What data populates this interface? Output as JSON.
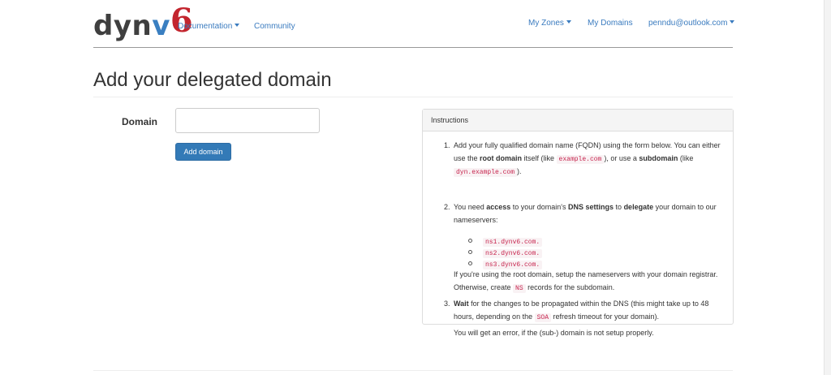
{
  "nav": {
    "logo_dyn": "dyn",
    "logo_v": "v",
    "logo_6": "6",
    "documentation": "Documentation",
    "community": "Community",
    "my_zones": "My Zones",
    "my_domains": "My Domains",
    "user_email": "penndu@outlook.com"
  },
  "page": {
    "title": "Add your delegated domain"
  },
  "form": {
    "domain_label": "Domain",
    "domain_value": "",
    "domain_placeholder": "",
    "submit_label": "Add domain"
  },
  "instructions": {
    "heading": "Instructions",
    "step1": {
      "num": "1.",
      "t1": "Add your fully qualified domain name (FQDN) using the form below. You can either use the ",
      "b1": "root domain",
      "t2": " itself (like ",
      "c1": "example.com",
      "t3": "), or use a ",
      "b2": "subdomain",
      "t4": " (like ",
      "c2": "dyn.example.com",
      "t5": ")."
    },
    "step2": {
      "num": "2.",
      "t1": "You need ",
      "b1": "access",
      "t2": " to your domain's ",
      "b2": "DNS settings",
      "t3": " to ",
      "b3": "delegate",
      "t4": " your domain to our nameservers:",
      "nameservers": [
        "ns1.dynv6.com.",
        "ns2.dynv6.com.",
        "ns3.dynv6.com."
      ],
      "n1": "If you're using the root domain, setup the nameservers with your domain registrar. Otherwise, create ",
      "c1": "NS",
      "n2": " records for the subdomain."
    },
    "step3": {
      "num": "3.",
      "b1": "Wait",
      "t1": " for the changes to be propagated within the DNS (this might take up to 48 hours, depending on the ",
      "c1": "SOA",
      "t2": " refresh timeout for your domain).",
      "note": "You will get an error, if the (sub-) domain is not setup properly."
    }
  }
}
